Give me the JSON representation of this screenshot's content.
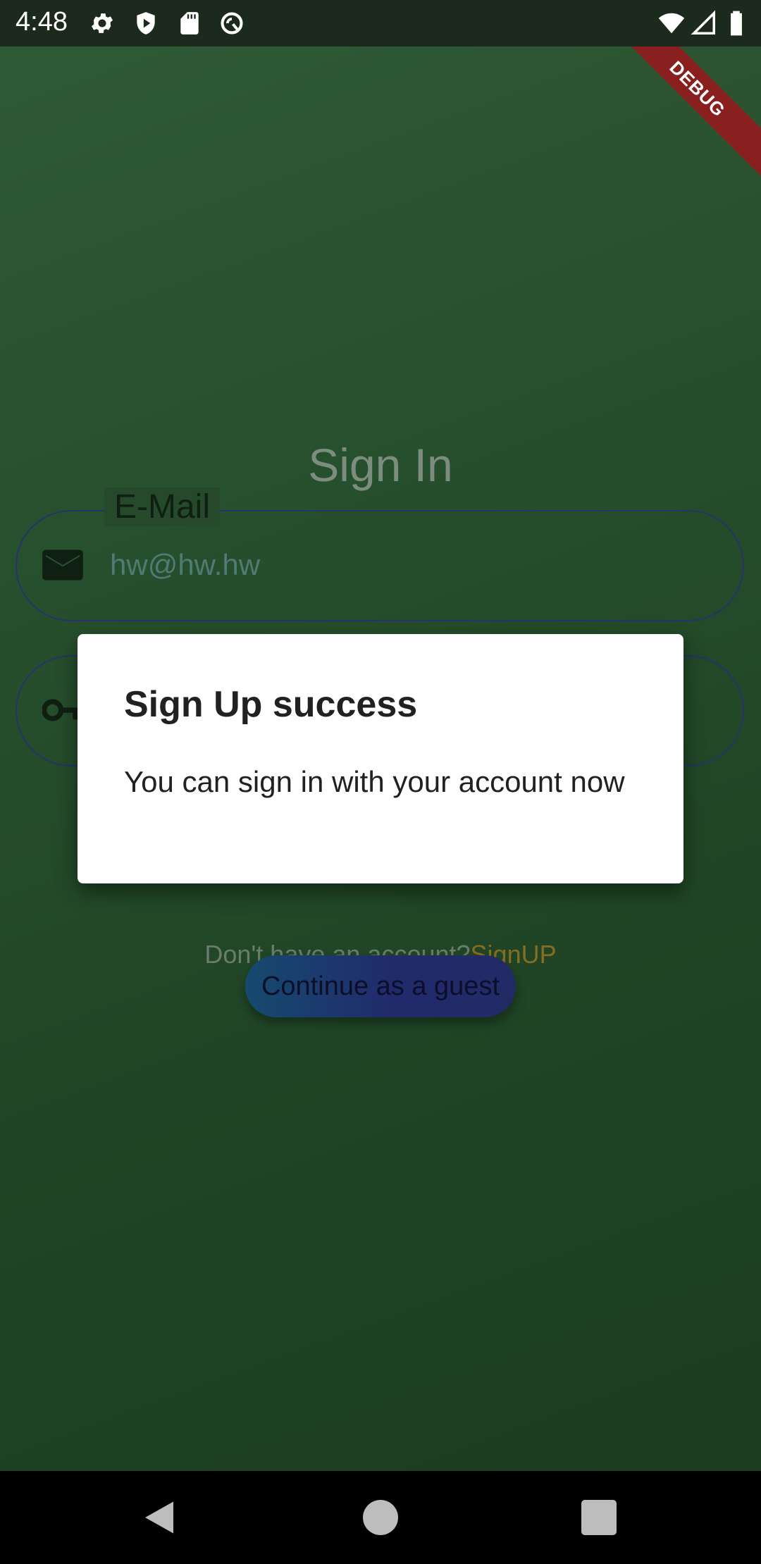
{
  "status_bar": {
    "time": "4:48",
    "icons": [
      "settings-icon",
      "shield-play-icon",
      "sd-card-icon",
      "sync-icon",
      "wifi-icon",
      "signal-icon",
      "battery-icon"
    ]
  },
  "debug_label": "DEBUG",
  "signin": {
    "title": "Sign In",
    "email_label": "E-Mail",
    "email_value": "hw@hw.hw",
    "email_icon": "mail-icon",
    "password_icon": "key-icon"
  },
  "signup_prompt": "Don't have an account?",
  "signup_link": "SignUP",
  "guest_button": "Continue as a guest",
  "dialog": {
    "title": "Sign Up success",
    "message": "You can sign in with your account now"
  },
  "nav_bar": [
    "back-icon",
    "home-icon",
    "recents-icon"
  ],
  "colors": {
    "background": "#27502e",
    "dialog": "#ffffff",
    "signup_link": "#876d22"
  }
}
